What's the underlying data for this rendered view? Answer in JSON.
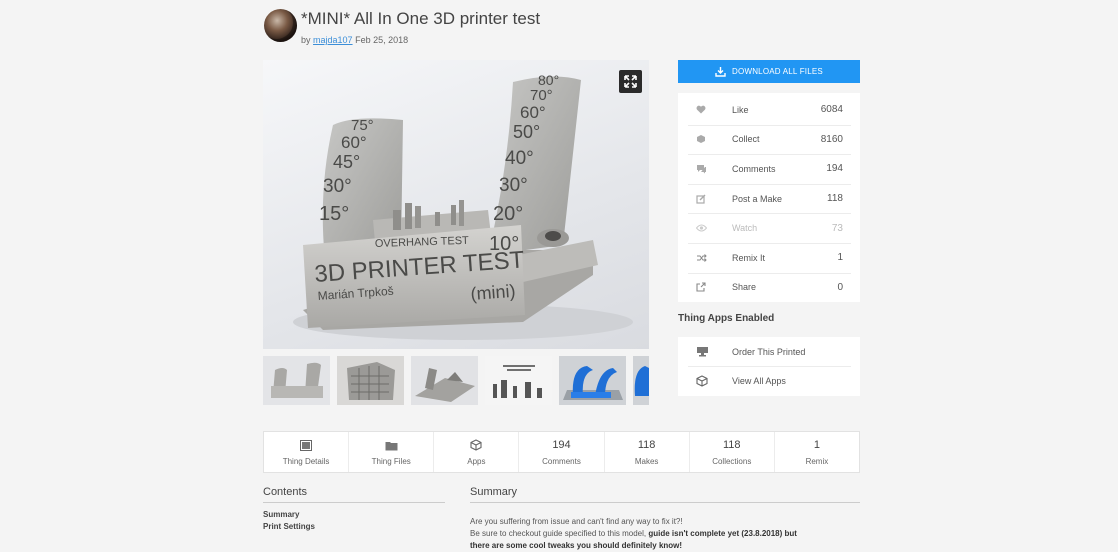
{
  "header": {
    "title": "*MINI* All In One 3D printer test",
    "by": "by",
    "author": "majda107",
    "date": "Feb 25, 2018"
  },
  "hero": {
    "print_labels_left": [
      "75°",
      "60°",
      "45°",
      "30°",
      "15°"
    ],
    "print_labels_right": [
      "80°",
      "70°",
      "60°",
      "50°",
      "40°",
      "30°",
      "20°",
      "10°"
    ],
    "print_overhang": "OVERHANG TEST",
    "print_title": "3D PRINTER TEST",
    "print_author": "Marián Trpkoš",
    "print_mini": "(mini)"
  },
  "thumbs": [
    {
      "name": "thumb-1"
    },
    {
      "name": "thumb-2"
    },
    {
      "name": "thumb-3"
    },
    {
      "name": "thumb-4"
    },
    {
      "name": "thumb-5"
    },
    {
      "name": "thumb-6"
    }
  ],
  "download": {
    "label": "DOWNLOAD ALL FILES"
  },
  "stats": [
    {
      "icon": "heart-icon",
      "label": "Like",
      "count": "6084"
    },
    {
      "icon": "collect-icon",
      "label": "Collect",
      "count": "8160"
    },
    {
      "icon": "comment-icon",
      "label": "Comments",
      "count": "194"
    },
    {
      "icon": "make-icon",
      "label": "Post a Make",
      "count": "118"
    },
    {
      "icon": "eye-icon",
      "label": "Watch",
      "count": "73"
    },
    {
      "icon": "remix-icon",
      "label": "Remix It",
      "count": "1"
    },
    {
      "icon": "share-icon",
      "label": "Share",
      "count": "0"
    }
  ],
  "apps": {
    "heading": "Thing Apps Enabled",
    "items": [
      {
        "icon": "printer-icon",
        "label": "Order This Printed"
      },
      {
        "icon": "cube-icon",
        "label": "View All Apps"
      }
    ]
  },
  "tabs": [
    {
      "icon": "details-icon",
      "label": "Thing Details"
    },
    {
      "icon": "files-icon",
      "label": "Thing Files"
    },
    {
      "icon": "apps-cube-icon",
      "label": "Apps"
    },
    {
      "count": "194",
      "label": "Comments"
    },
    {
      "count": "118",
      "label": "Makes"
    },
    {
      "count": "118",
      "label": "Collections"
    },
    {
      "count": "1",
      "label": "Remix"
    }
  ],
  "contents": {
    "heading": "Contents",
    "links": [
      "Summary",
      "Print Settings"
    ]
  },
  "summary": {
    "heading": "Summary",
    "line1": "Are you suffering from issue and can't find any way to fix it?!",
    "line2_normal": "Be sure to checkout guide specified to this model,",
    "line2_bold": "guide isn't complete yet (23.8.2018) but",
    "line3_bold": "there are some cool tweaks you should definitely know!"
  }
}
